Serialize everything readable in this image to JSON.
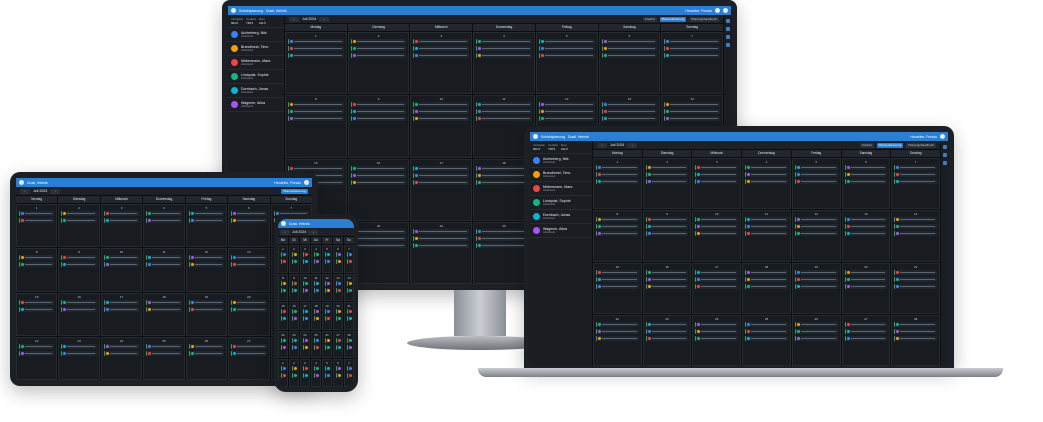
{
  "app": {
    "title": "Schichtplanung",
    "user": "Heuchler, Fresdo",
    "profile": "Dustl, Heinrik",
    "month_label": "Juli 2024",
    "toolbar_buttons": [
      "Ansicht",
      "Planverfeinerung",
      "Planungshandbuch"
    ]
  },
  "weekdays": [
    "Montag",
    "Dienstag",
    "Mittwoch",
    "Donnerstag",
    "Freitag",
    "Samstag",
    "Sonntag"
  ],
  "weekdays_short": [
    "Mo",
    "Di",
    "Mi",
    "Do",
    "Fr",
    "Sa",
    "So"
  ],
  "day_numbers": [
    "1",
    "2",
    "3",
    "4",
    "5",
    "6",
    "7",
    "8",
    "9",
    "10",
    "11",
    "12",
    "13",
    "14",
    "15",
    "16",
    "17",
    "18",
    "19",
    "20",
    "21",
    "22",
    "23",
    "24",
    "25",
    "26",
    "27",
    "28"
  ],
  "stats": {
    "label_a": "Verfügbar",
    "label_b": "Geplant",
    "label_c": "Rest",
    "val_a": "960.0",
    "val_b": "748.5",
    "val_c": "211.5"
  },
  "employees": [
    {
      "name": "Achterberg, Nils",
      "sub": "Arbeitszeit",
      "color": "#3b82f6"
    },
    {
      "name": "Brandhorst, Timo",
      "sub": "Arbeitszeit",
      "color": "#f59e0b"
    },
    {
      "name": "Möbermann, Mara",
      "sub": "Arbeitszeit",
      "color": "#ef4444"
    },
    {
      "name": "Lindquist, Sophie",
      "sub": "Arbeitszeit",
      "color": "#10b981"
    },
    {
      "name": "Dornbach, Jonas",
      "sub": "Arbeitszeit",
      "color": "#06b6d4"
    },
    {
      "name": "Wagener, Alina",
      "sub": "Arbeitszeit",
      "color": "#a855f7"
    }
  ],
  "colors": {
    "accent": "#2a7fd4",
    "bg": "#14171b",
    "shift": "#3aa35a"
  }
}
